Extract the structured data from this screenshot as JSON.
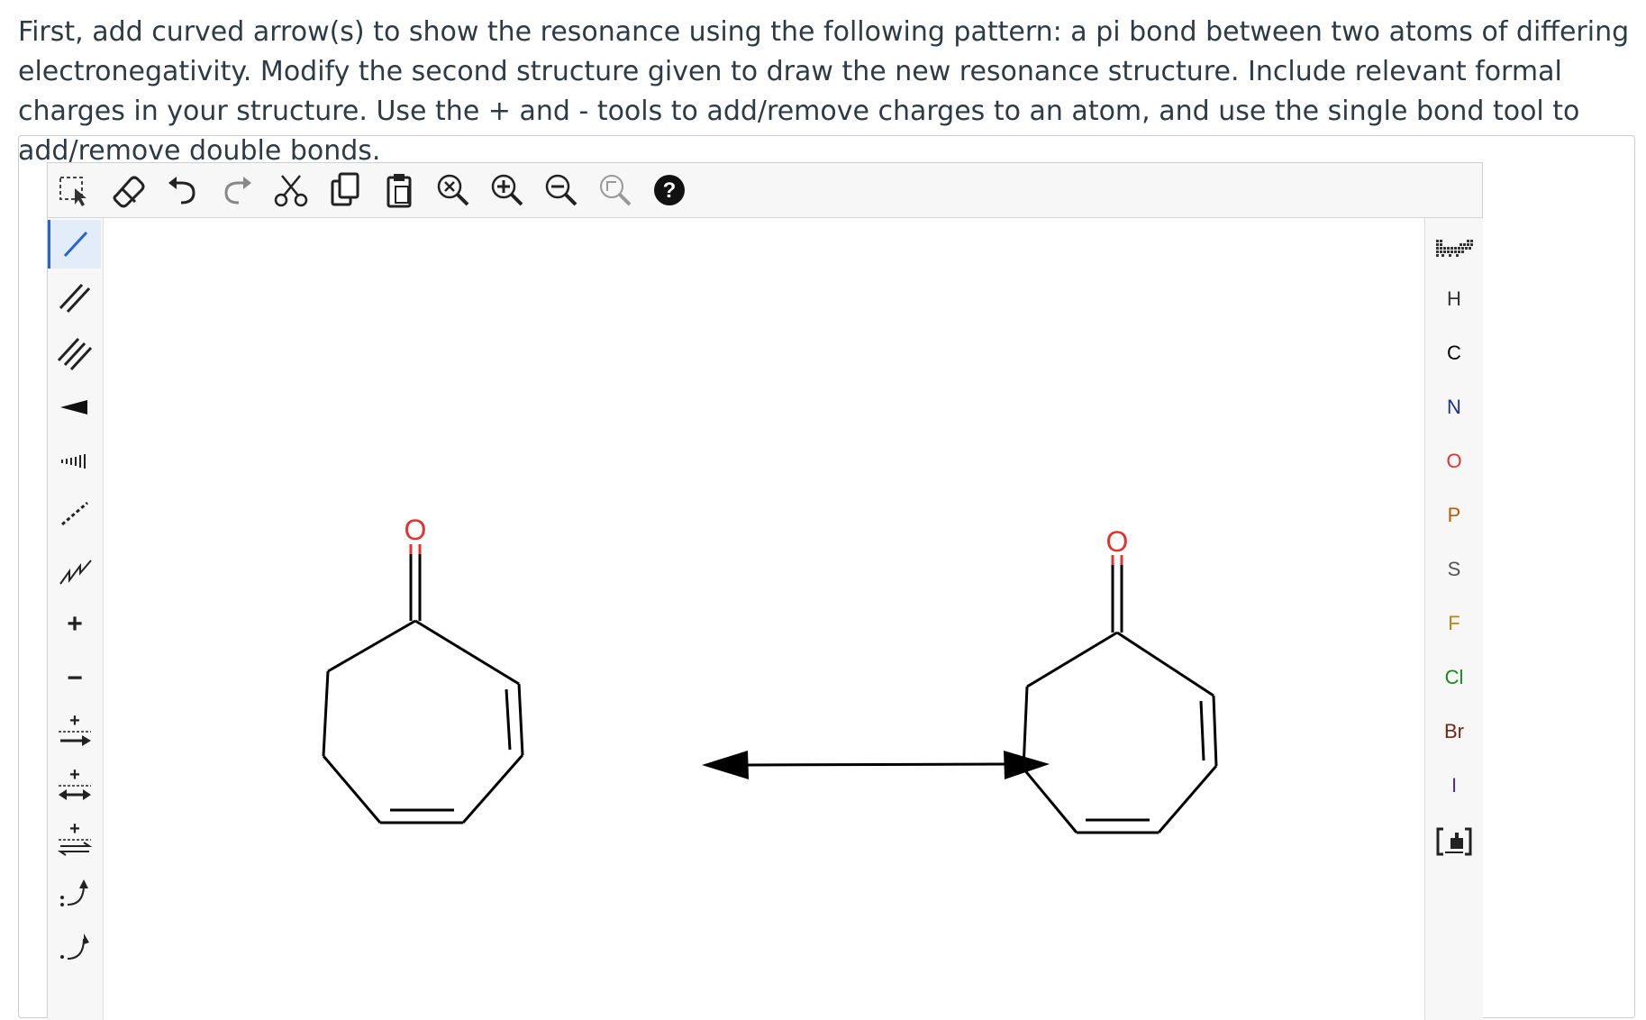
{
  "question": {
    "text": "First, add curved arrow(s) to show the resonance using the following pattern: a pi bond between two atoms of differing electronegativity. Modify the second structure given to draw the new resonance structure. Include relevant formal charges in your structure. Use the + and - tools to add/remove charges to an atom, and use the single bond tool to add/remove double bonds."
  },
  "top_toolbar": {
    "items": [
      {
        "name": "select-tool-icon"
      },
      {
        "name": "eraser-icon"
      },
      {
        "name": "undo-icon"
      },
      {
        "name": "redo-icon"
      },
      {
        "name": "cut-icon"
      },
      {
        "name": "copy-icon"
      },
      {
        "name": "paste-icon"
      },
      {
        "name": "zoom-reset-icon"
      },
      {
        "name": "zoom-in-icon"
      },
      {
        "name": "zoom-out-icon"
      },
      {
        "name": "zoom-fit-icon"
      },
      {
        "name": "help-icon",
        "label": "?"
      }
    ]
  },
  "left_toolbar": {
    "active": "single-bond-tool",
    "items": [
      {
        "name": "single-bond-tool"
      },
      {
        "name": "double-bond-tool"
      },
      {
        "name": "triple-bond-tool"
      },
      {
        "name": "wedge-bond-tool"
      },
      {
        "name": "hash-bond-tool"
      },
      {
        "name": "dashed-bond-tool"
      },
      {
        "name": "chain-tool"
      },
      {
        "name": "positive-charge-tool",
        "label": "+"
      },
      {
        "name": "negative-charge-tool",
        "label": "−"
      },
      {
        "name": "reaction-arrow-tool"
      },
      {
        "name": "resonance-arrow-tool"
      },
      {
        "name": "equilibrium-arrow-tool"
      },
      {
        "name": "electron-pair-arrow-tool"
      },
      {
        "name": "single-electron-arrow-tool"
      }
    ]
  },
  "right_toolbar": {
    "atoms": [
      {
        "symbol": "H",
        "color": "#333333"
      },
      {
        "symbol": "C",
        "color": "#000000"
      },
      {
        "symbol": "N",
        "color": "#1f2f8a"
      },
      {
        "symbol": "O",
        "color": "#e3332c"
      },
      {
        "symbol": "P",
        "color": "#b85a00"
      },
      {
        "symbol": "S",
        "color": "#555555"
      },
      {
        "symbol": "F",
        "color": "#b8860b"
      },
      {
        "symbol": "Cl",
        "color": "#1a8a1a"
      },
      {
        "symbol": "Br",
        "color": "#6b2a1a"
      },
      {
        "symbol": "I",
        "color": "#5a2a8a"
      }
    ]
  },
  "canvas": {
    "structure1_oxygen_label": "O",
    "structure2_oxygen_label": "O"
  },
  "colors": {
    "oxygen": "#e3332c",
    "bond": "#000000",
    "active_tool": "#2563d6"
  }
}
